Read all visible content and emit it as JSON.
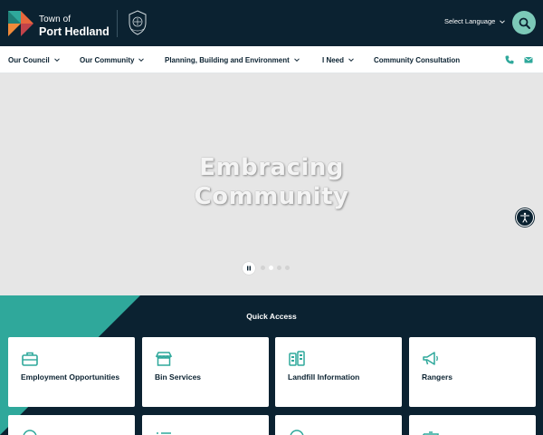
{
  "header": {
    "logo_small": "Town of",
    "logo_big": "Port Hedland",
    "language_label": "Select Language"
  },
  "nav": {
    "items": [
      {
        "label": "Our Council",
        "has_dropdown": true
      },
      {
        "label": "Our Community",
        "has_dropdown": true
      },
      {
        "label": "Planning, Building and Environment",
        "has_dropdown": true
      },
      {
        "label": "I Need",
        "has_dropdown": true
      },
      {
        "label": "Community Consultation",
        "has_dropdown": false
      }
    ],
    "icons": [
      "phone-icon",
      "mail-icon"
    ]
  },
  "hero": {
    "title_line1": "Embracing",
    "title_line2": "Community",
    "slide_count": 4,
    "active_slide": 1
  },
  "quick_access": {
    "title": "Quick Access",
    "cards": [
      {
        "label": "Employment Opportunities",
        "icon": "briefcase-icon"
      },
      {
        "label": "Bin Services",
        "icon": "store-icon"
      },
      {
        "label": "Landfill Information",
        "icon": "building-icon"
      },
      {
        "label": "Rangers",
        "icon": "megaphone-icon"
      }
    ],
    "cards_row2_icons": [
      "info-icon",
      "list-icon",
      "globe-icon",
      "ticket-icon"
    ]
  },
  "colors": {
    "dark": "#0b2231",
    "teal": "#2fa89b",
    "accent": "#7cc9b8",
    "hero_bg": "#e6e6e6"
  }
}
